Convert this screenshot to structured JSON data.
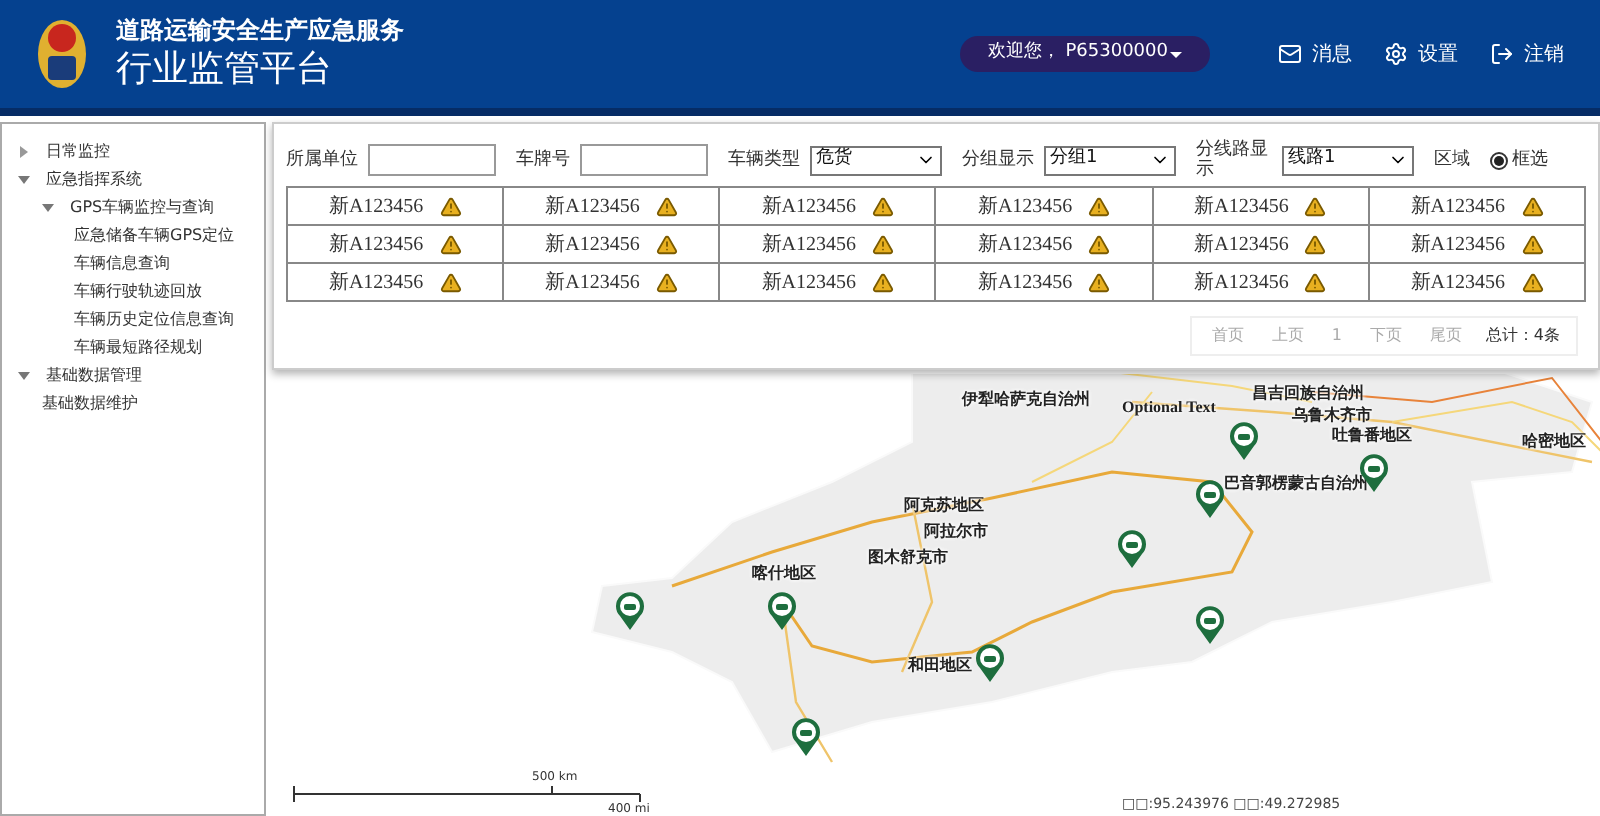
{
  "header": {
    "subtitle": "道路运输安全生产应急服务",
    "title": "行业监管平台",
    "user": "欢迎您， P65300000",
    "actions": [
      {
        "kind": "mail",
        "label": "消息"
      },
      {
        "kind": "gear",
        "label": "设置"
      },
      {
        "kind": "logout",
        "label": "注销"
      }
    ]
  },
  "sidebar": {
    "items": [
      {
        "label": "日常监控",
        "expanded": false
      },
      {
        "label": "应急指挥系统",
        "expanded": true,
        "children": [
          {
            "label": "GPS车辆监控与查询",
            "expanded": true,
            "children": [
              {
                "label": "应急储备车辆GPS定位"
              },
              {
                "label": "车辆信息查询"
              },
              {
                "label": "车辆行驶轨迹回放"
              },
              {
                "label": "车辆历史定位信息查询"
              },
              {
                "label": "车辆最短路径规划"
              }
            ]
          }
        ]
      },
      {
        "label": "基础数据管理",
        "expanded": true,
        "children": [
          {
            "label": "基础数据维护"
          }
        ]
      }
    ]
  },
  "filters": [
    {
      "kind": "input",
      "label": "所属单位"
    },
    {
      "kind": "input",
      "label": "车牌号"
    },
    {
      "kind": "select",
      "label": "车辆类型",
      "value": "危货"
    },
    {
      "kind": "select",
      "label": "分组显示",
      "value": "分组1"
    },
    {
      "kind": "select",
      "label": "分线路显示",
      "value": "线路1"
    },
    {
      "kind": "text",
      "label": "区域"
    },
    {
      "kind": "radio",
      "label": "框选",
      "checked": true
    }
  ],
  "vehicles": [
    [
      "新A123456",
      "新A123456",
      "新A123456",
      "新A123456",
      "新A123456",
      "新A123456"
    ],
    [
      "新A123456",
      "新A123456",
      "新A123456",
      "新A123456",
      "新A123456",
      "新A123456"
    ],
    [
      "新A123456",
      "新A123456",
      "新A123456",
      "新A123456",
      "新A123456",
      "新A123456"
    ]
  ],
  "pagination": {
    "buttons": [
      {
        "label": "首页",
        "disabled": true
      },
      {
        "label": "上页",
        "disabled": true
      },
      {
        "label": "1",
        "disabled": true
      },
      {
        "label": "下页",
        "disabled": true
      },
      {
        "label": "尾页",
        "disabled": true
      }
    ],
    "total": "总计：4条"
  },
  "map": {
    "labels": [
      "伊犁哈萨克自治州",
      "昌吉回族自治州",
      "Optional Text",
      "乌鲁木齐市",
      "吐鲁番地区",
      "哈密地区",
      "巴音郭楞蒙古自治州",
      "阿克苏地区",
      "阿拉尔市",
      "图木舒克市",
      "喀什地区",
      "和田地区"
    ],
    "scale_km": "500 km",
    "scale_mi": "400 mi",
    "coordinates": "□□:95.243976 □□:49.272985"
  }
}
